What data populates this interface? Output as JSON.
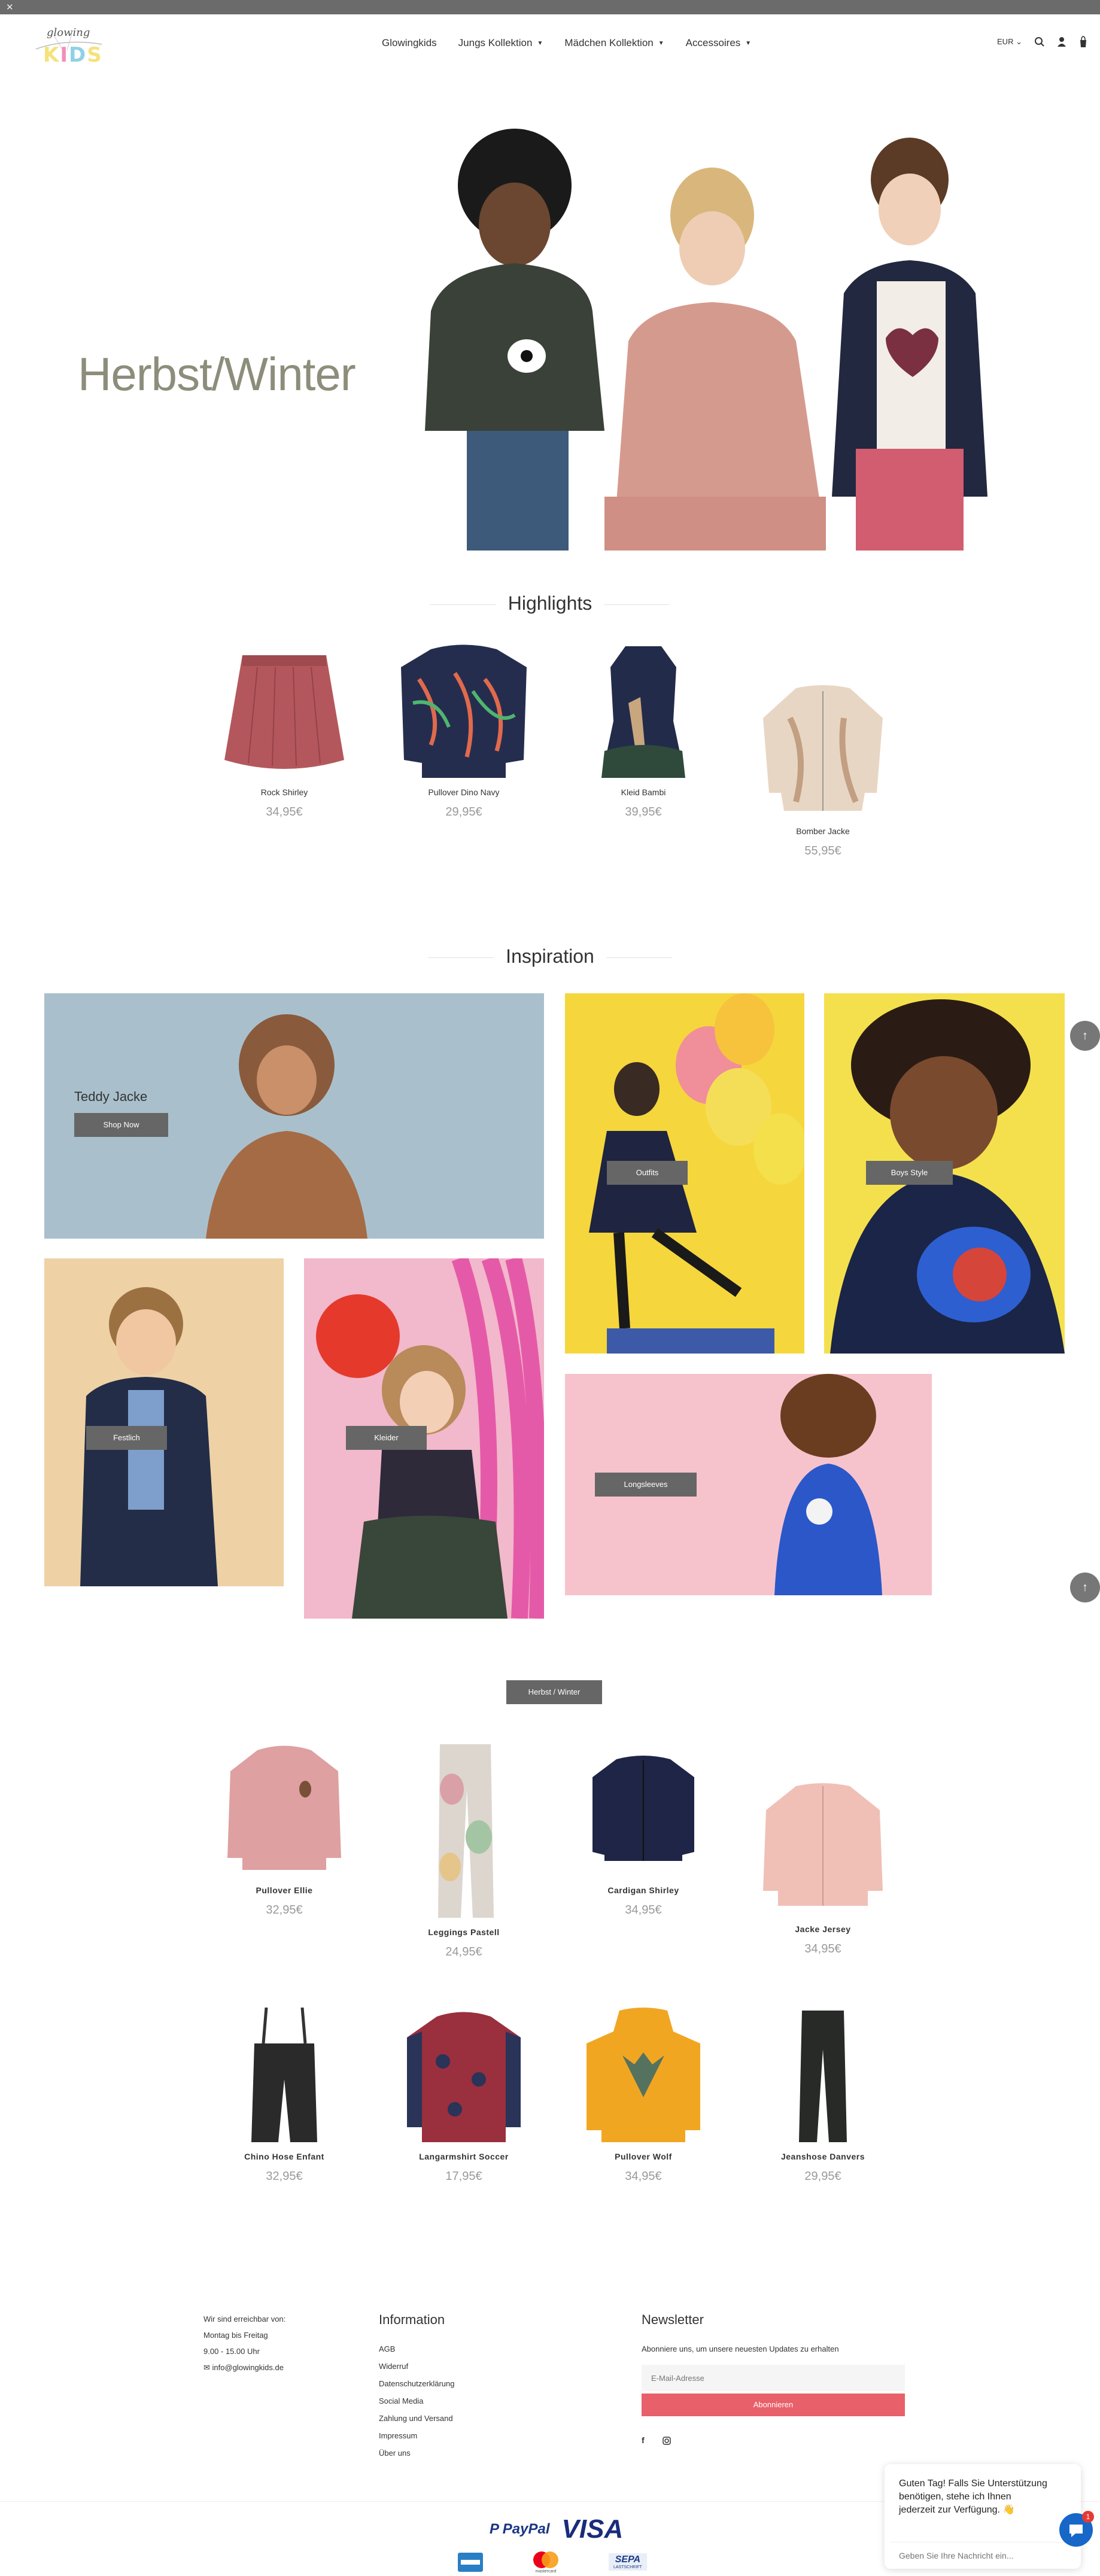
{
  "header": {
    "close_glyph": "✕",
    "logo_script": "glowing",
    "logo_kids": "KIDS",
    "nav": [
      {
        "label": "Glowingkids",
        "caret": ""
      },
      {
        "label": "Jungs Kollektion",
        "caret": "▼"
      },
      {
        "label": "Mädchen Kollektion",
        "caret": "▼"
      },
      {
        "label": "Accessoires",
        "caret": "▼"
      }
    ],
    "currency": "EUR",
    "currency_caret": "⌄"
  },
  "hero": {
    "title": "Herbst/Winter"
  },
  "highlights": {
    "title": "Highlights",
    "products": [
      {
        "name": "Rock Shirley",
        "price": "34,95€"
      },
      {
        "name": "Pullover Dino Navy",
        "price": "29,95€"
      },
      {
        "name": "Kleid Bambi",
        "price": "39,95€"
      },
      {
        "name": "Bomber Jacke",
        "price": "55,95€"
      }
    ]
  },
  "inspiration": {
    "title": "Inspiration",
    "teddy_title": "Teddy Jacke",
    "shop_now": "Shop Now",
    "outfits": "Outfits",
    "boys_style": "Boys Style",
    "festlich": "Festlich",
    "kleider": "Kleider",
    "longsleeves": "Longsleeves"
  },
  "collection": {
    "tag": "Herbst / Winter",
    "products": [
      {
        "name": "Pullover Ellie",
        "price": "32,95€"
      },
      {
        "name": "Leggings Pastell",
        "price": "24,95€"
      },
      {
        "name": "Cardigan Shirley",
        "price": "34,95€"
      },
      {
        "name": "Jacke Jersey",
        "price": "34,95€"
      },
      {
        "name": "Chino Hose Enfant",
        "price": "32,95€"
      },
      {
        "name": "Langarmshirt Soccer",
        "price": "17,95€"
      },
      {
        "name": "Pullover Wolf",
        "price": "34,95€"
      },
      {
        "name": "Jeanshose Danvers",
        "price": "29,95€"
      }
    ]
  },
  "footer": {
    "contact": [
      "Wir sind erreichbar von:",
      "Montag bis Freitag",
      "9.00 - 15.00 Uhr"
    ],
    "email": "info@glowingkids.de",
    "info_title": "Information",
    "info_links": [
      "AGB",
      "Widerruf",
      "Datenschutzerklärung",
      "Social Media",
      "Zahlung und Versand",
      "Impressum",
      "Über uns"
    ],
    "newsletter_title": "Newsletter",
    "newsletter_text": "Abonniere uns, um unsere neuesten Updates zu erhalten",
    "email_placeholder": "E-Mail-Adresse",
    "subscribe": "Abonnieren",
    "facebook": "f",
    "paypal": "PayPal",
    "visa": "VISA",
    "sepa": "SEPA",
    "sepa_sub": "LASTSCHRIFT",
    "mastercard": "mastercard"
  },
  "chat": {
    "message": "Guten Tag! Falls Sie Unterstützung benötigen, stehe ich Ihnen jederzeit zur Verfügung. 👋",
    "placeholder": "Geben Sie Ihre Nachricht ein...",
    "badge": "1"
  },
  "colors": {
    "accent": "#e8606a",
    "button": "#666666",
    "hero_text": "#8d8d7b"
  }
}
